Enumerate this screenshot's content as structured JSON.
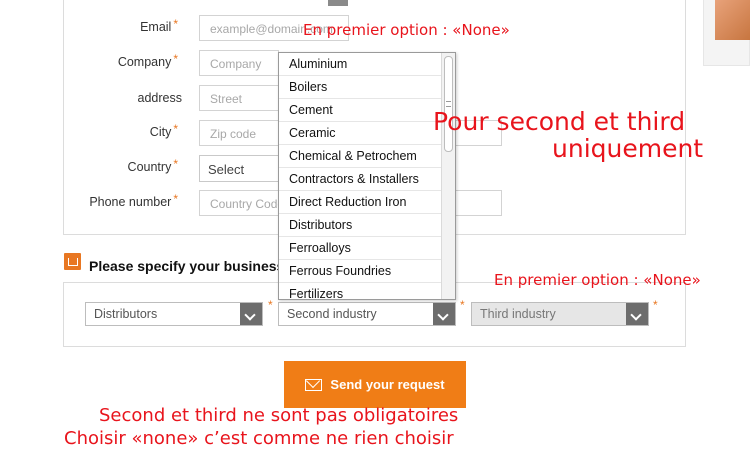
{
  "form": {
    "fields": [
      {
        "label": "Email",
        "required": "*",
        "placeholder": "example@domain.com"
      },
      {
        "label": "Company",
        "required": "*",
        "placeholder": "Company"
      },
      {
        "label": "address",
        "required": "",
        "placeholder": "Street"
      },
      {
        "label": "City",
        "required": "*",
        "placeholder": "Zip code"
      },
      {
        "label": "Country",
        "required": "*",
        "value": "Select"
      },
      {
        "label": "Phone number",
        "required": "*",
        "placeholder": "Country Code"
      }
    ]
  },
  "dropdown": {
    "options": [
      "Aluminium",
      "Boilers",
      "Cement",
      "Ceramic",
      "Chemical & Petrochem",
      "Contractors & Installers",
      "Direct Reduction Iron",
      "Distributors",
      "Ferroalloys",
      "Ferrous Foundries",
      "Fertilizers"
    ]
  },
  "industry": {
    "title": "Please specify your business",
    "first_value": "Distributors",
    "second_value": "Second industry",
    "third_value": "Third industry",
    "required": "*"
  },
  "send_button": {
    "label": "Send your request",
    "icon": "mail-icon"
  },
  "annotations": {
    "top": "En premier option : «None»",
    "side_line1": "Pour second et third",
    "side_line2": "uniquement",
    "right": "En premier option : «None»",
    "bottom_line1": "Second et third ne sont pas obligatoires",
    "bottom_line2": "Choisir «none» c’est comme ne rien choisir"
  },
  "colors": {
    "accent": "#f07d16",
    "annotation": "#e8141c"
  }
}
